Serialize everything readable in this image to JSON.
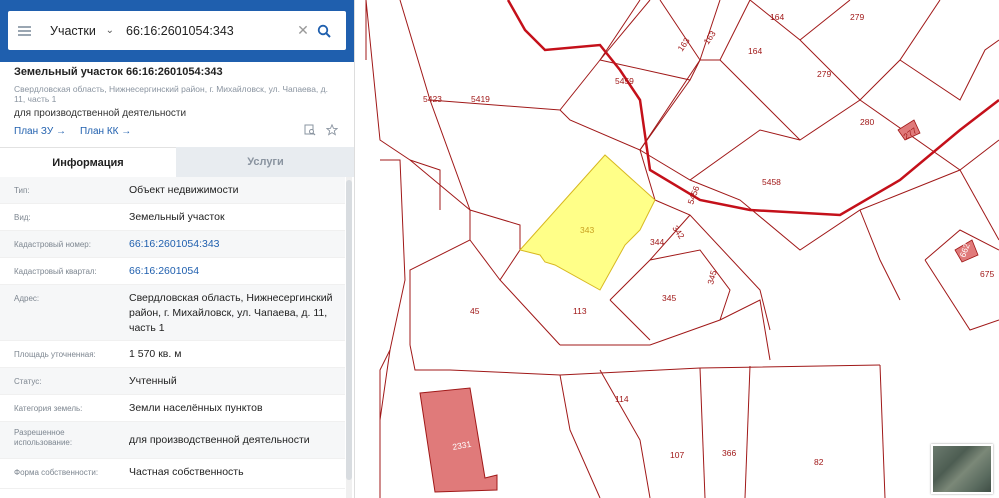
{
  "search": {
    "layer": "Участки",
    "query": "66:16:2601054:343"
  },
  "object": {
    "title": "Земельный участок 66:16:2601054:343",
    "address_short": "Свердловская область, Нижнесергинский район, г. Михайловск, ул. Чапаева, д. 11, часть 1",
    "purpose": "для производственной деятельности",
    "plan_zu": "План ЗУ →",
    "plan_kk": "План КК →"
  },
  "tabs": {
    "info": "Информация",
    "services": "Услуги"
  },
  "rows": [
    {
      "label": "Тип:",
      "value": "Объект недвижимости"
    },
    {
      "label": "Вид:",
      "value": "Земельный участок"
    },
    {
      "label": "Кадастровый номер:",
      "value": "66:16:2601054:343"
    },
    {
      "label": "Кадастровый квартал:",
      "value": "66:16:2601054"
    },
    {
      "label": "Адрес:",
      "value": "Свердловская область, Нижнесергинский район, г. Михайловск, ул. Чапаева, д. 11, часть 1"
    },
    {
      "label": "Площадь уточненная:",
      "value": "1 570 кв. м"
    },
    {
      "label": "Статус:",
      "value": "Учтенный"
    },
    {
      "label": "Категория земель:",
      "value": "Земли населённых пунктов"
    },
    {
      "label": "Разрешенное использование:",
      "value": "для производственной деятельности"
    },
    {
      "label": "Форма собственности:",
      "value": "Частная собственность"
    }
  ],
  "colors": {
    "header": "#1f5fae",
    "parcel_line": "#a01818",
    "boundary": "#c4101a",
    "selected_fill": "#ffff88",
    "building_fill": "#e07a7a"
  },
  "map_labels": {
    "l164a": "164",
    "l279a": "279",
    "l163a": "163",
    "l163b": "163",
    "l164b": "164",
    "l279b": "279",
    "l5459": "5459",
    "l5423": "5423",
    "l5419": "5419",
    "l280": "280",
    "l277": "277",
    "l5458": "5458",
    "l5456": "5456",
    "l343": "343",
    "l344": "344",
    "l342": "342",
    "l662": "662",
    "l675": "675",
    "l345a": "345",
    "l345b": "345",
    "l45": "45",
    "l113": "113",
    "l114": "114",
    "l2331": "2331",
    "l107": "107",
    "l366": "366",
    "l82": "82"
  }
}
